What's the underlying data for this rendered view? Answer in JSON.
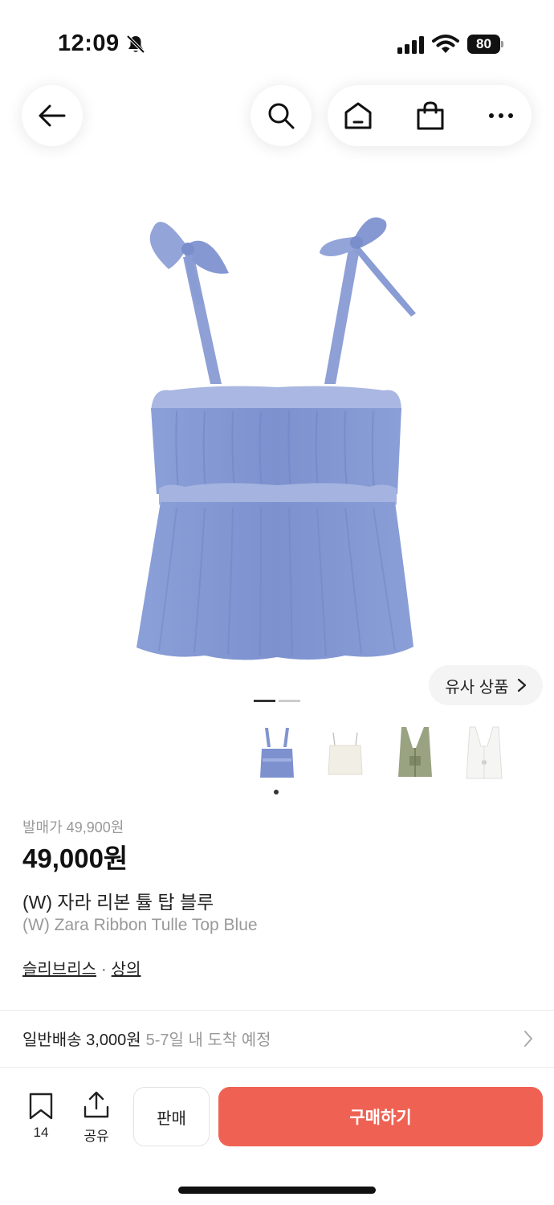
{
  "status_bar": {
    "time": "12:09",
    "battery": "80"
  },
  "product": {
    "release_price_label": "발매가 49,900원",
    "price": "49,000원",
    "name_ko": "(W) 자라 리본 튤 탑 블루",
    "name_en": "(W) Zara Ribbon Tulle Top Blue",
    "brand": "슬리브리스",
    "separator": "·",
    "category": "상의"
  },
  "similar_button": {
    "label": "유사 상품"
  },
  "delivery": {
    "label": "일반배송 3,000원",
    "eta": "5-7일 내 도착 예정"
  },
  "bottom_bar": {
    "bookmark_count": "14",
    "share_label": "공유",
    "sell_label": "판매",
    "buy_label": "구매하기"
  },
  "colors": {
    "accent": "#ef6253",
    "product_blue": "#7f93d0",
    "muted_text": "#999999"
  },
  "icons": [
    "back-arrow-icon",
    "search-icon",
    "home-icon",
    "shopping-bag-icon",
    "more-icon",
    "bookmark-icon",
    "share-icon",
    "chevron-right-icon",
    "bell-slash-icon",
    "signal-icon",
    "wifi-icon"
  ]
}
